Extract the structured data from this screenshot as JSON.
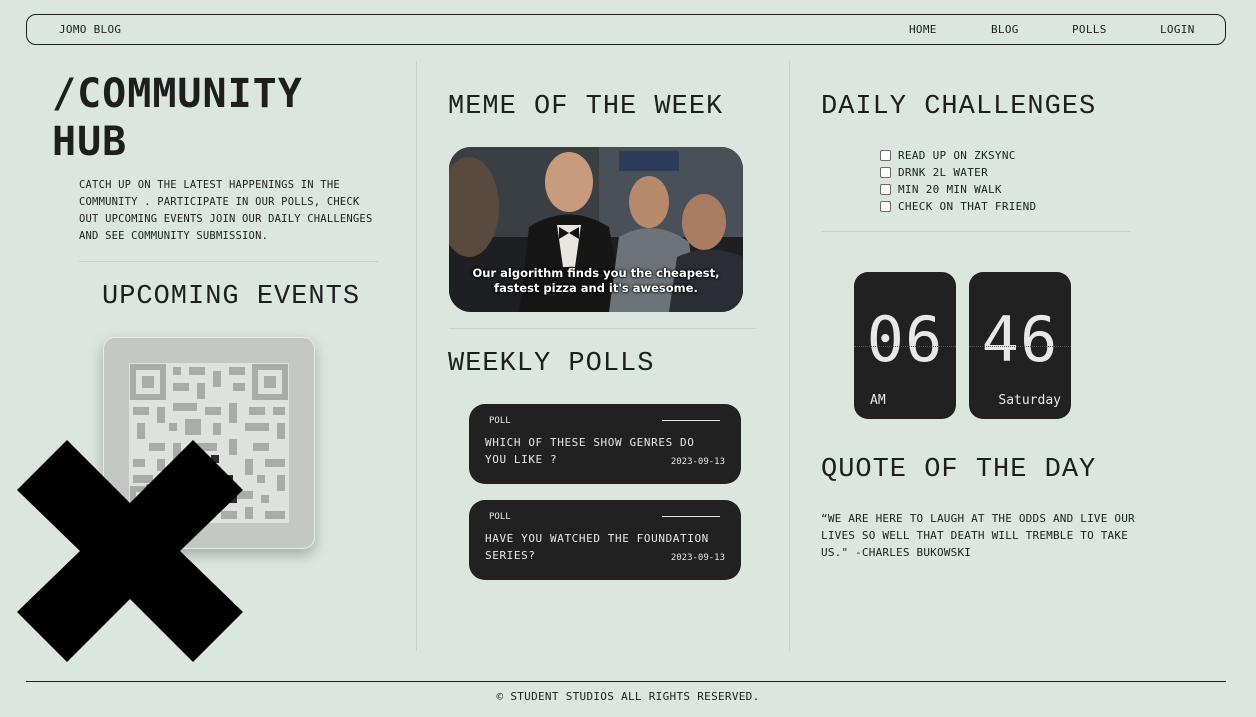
{
  "nav": {
    "brand": "JOMO BLOG",
    "links": [
      "HOME",
      "BLOG",
      "POLLS",
      "LOGIN"
    ]
  },
  "hub": {
    "title": "/COMMUNITY HUB",
    "intro": "CATCH UP ON THE LATEST HAPPENINGS IN THE COMMUNITY . PARTICIPATE IN OUR POLLS, CHECK OUT UPCOMING EVENTS JOIN OUR DAILY CHALLENGES AND SEE COMMUNITY SUBMISSION.",
    "events_title": "UPCOMING EVENTS"
  },
  "meme": {
    "title": "MEME OF THE WEEK",
    "caption_line1": "Our algorithm finds you the cheapest,",
    "caption_line2": "fastest pizza and it's awesome."
  },
  "polls": {
    "title": "WEEKLY POLLS",
    "items": [
      {
        "tag": "POLL",
        "question": "WHICH OF THESE SHOW GENRES DO YOU LIKE ?",
        "date": "2023-09-13"
      },
      {
        "tag": "POLL",
        "question": "HAVE YOU WATCHED THE FOUNDATION SERIES?",
        "date": "2023-09-13"
      }
    ]
  },
  "challenges": {
    "title": "DAILY CHALLENGES",
    "items": [
      "READ UP ON ZKSYNC",
      "DRNK 2L WATER",
      "MIN 20 MIN WALK",
      "CHECK ON THAT FRIEND"
    ]
  },
  "clock": {
    "hour": "06",
    "period": "AM",
    "minute": "46",
    "day": "Saturday"
  },
  "quote": {
    "title": "QUOTE OF THE DAY",
    "text": "“WE ARE HERE TO LAUGH AT THE ODDS AND LIVE OUR LIVES SO WELL THAT DEATH WILL TREMBLE TO TAKE US.\" -CHARLES BUKOWSKI"
  },
  "footer": {
    "text": "© STUDENT STUDIOS ALL RIGHTS RESERVED."
  }
}
